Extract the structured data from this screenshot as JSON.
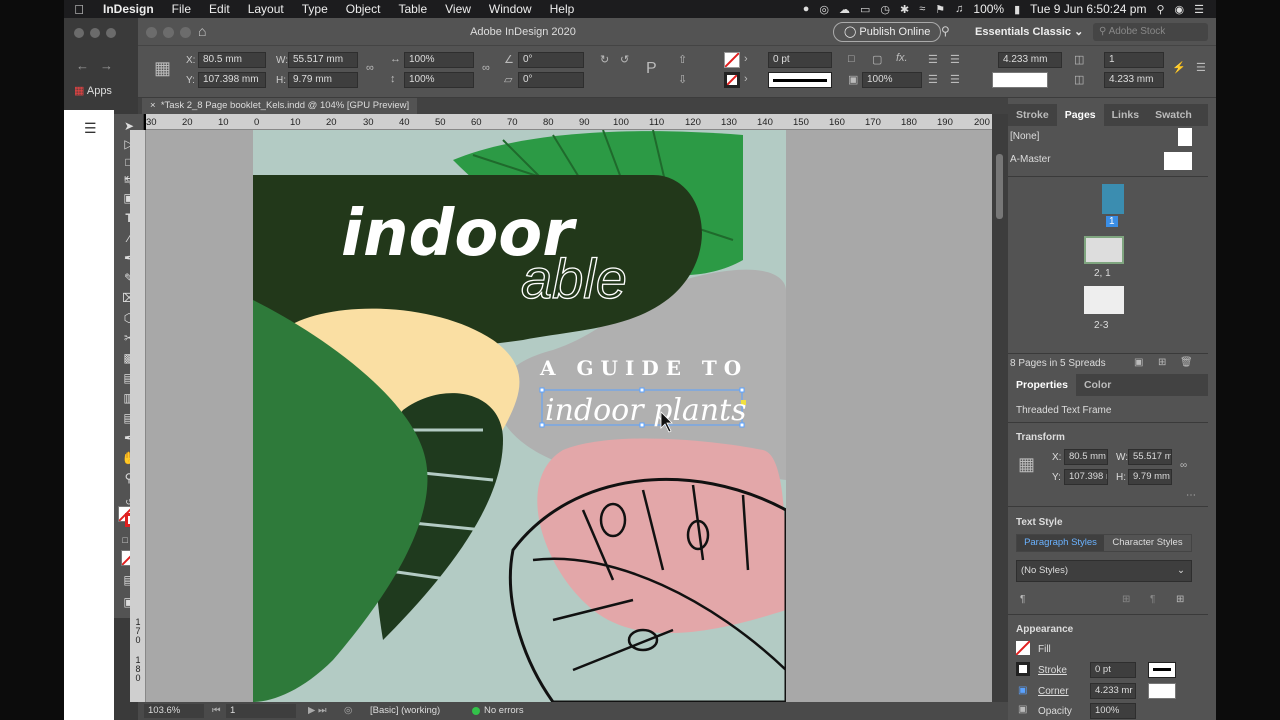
{
  "menubar": {
    "app": "InDesign",
    "items": [
      "File",
      "Edit",
      "Layout",
      "Type",
      "Object",
      "Table",
      "View",
      "Window",
      "Help"
    ],
    "battery": "100%",
    "clock": "Tue 9 Jun  6:50:24 pm"
  },
  "browser": {
    "apps_label": "Apps"
  },
  "titlebar": {
    "title": "Adobe InDesign 2020",
    "publish_label": "Publish Online",
    "workspace": "Essentials Classic",
    "stock_placeholder": "Adobe Stock"
  },
  "control": {
    "x_label": "X:",
    "x_value": "80.5 mm",
    "y_label": "Y:",
    "y_value": "107.398 mm",
    "w_label": "W:",
    "w_value": "55.517 mm",
    "h_label": "H:",
    "h_value": "9.79 mm",
    "scale_x": "100%",
    "scale_y": "100%",
    "rotate": "0°",
    "shear": "0°",
    "stroke_weight": "0 pt",
    "opacity": "100%",
    "corner_top": "4.233 mm",
    "corner_bottom": "4.233 mm",
    "columns": "1"
  },
  "document": {
    "tab_label": "*Task 2_8 Page booklet_Kels.indd @ 104% [GPU Preview]",
    "ruler_h": [
      "30",
      "20",
      "10",
      "0",
      "10",
      "20",
      "30",
      "40",
      "50",
      "60",
      "70",
      "80",
      "90",
      "100",
      "110",
      "120",
      "130",
      "140",
      "150",
      "160",
      "170",
      "180",
      "190",
      "200"
    ],
    "ruler_v": [
      "170",
      "180"
    ]
  },
  "artwork": {
    "title_bold": "indoor",
    "title_light": "able",
    "subtitle": "A GUIDE TO",
    "script_text": "indoor plants"
  },
  "statusbar": {
    "zoom": "103.6%",
    "page": "1",
    "profile": "[Basic] (working)",
    "errors": "No errors"
  },
  "panels": {
    "top_tabs": [
      "Stroke",
      "Pages",
      "Links",
      "Swatch"
    ],
    "active_top_tab": "Pages",
    "none_master": "[None]",
    "a_master": "A-Master",
    "page_labels": [
      "1",
      "2, 1",
      "2-3"
    ],
    "pages_summary": "8 Pages in 5 Spreads",
    "prop_tabs": [
      "Properties",
      "Color"
    ],
    "active_prop_tab": "Properties",
    "object_type": "Threaded Text Frame",
    "transform_heading": "Transform",
    "t_x_label": "X:",
    "t_x": "80.5 mm",
    "t_y_label": "Y:",
    "t_y": "107.398 r",
    "t_w_label": "W:",
    "t_w": "55.517 m",
    "t_h_label": "H:",
    "t_h": "9.79 mm",
    "text_style_heading": "Text Style",
    "paragraph_styles": "Paragraph Styles",
    "character_styles": "Character Styles",
    "style_value": "(No Styles)",
    "appearance_heading": "Appearance",
    "fill_label": "Fill",
    "stroke_label": "Stroke",
    "stroke_value": "0 pt",
    "corner_label": "Corner",
    "corner_value": "4.233 mr",
    "opacity_label": "Opacity",
    "opacity_value": "100%"
  },
  "colors": {
    "ui_panel": "#535353",
    "accent_blue": "#3a8ee6",
    "page_bg": "#b3cbc4",
    "dark_green": "#22381a",
    "leaf_green": "#2e7a3a",
    "bright_green": "#2c9a45",
    "cream": "#fadfa3",
    "pink": "#e3a7a9",
    "grey_blob": "#b0b0b0"
  }
}
